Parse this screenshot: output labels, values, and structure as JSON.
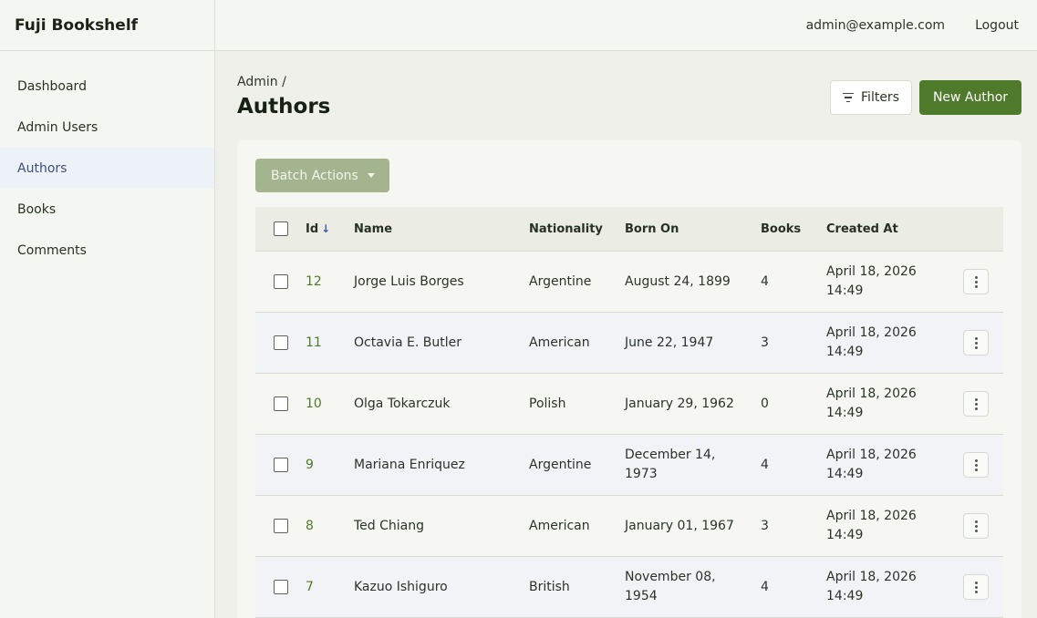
{
  "app": {
    "title": "Fuji Bookshelf"
  },
  "topbar": {
    "email": "admin@example.com",
    "logout": "Logout"
  },
  "sidebar": {
    "items": [
      {
        "label": "Dashboard"
      },
      {
        "label": "Admin Users"
      },
      {
        "label": "Authors",
        "active": true
      },
      {
        "label": "Books"
      },
      {
        "label": "Comments"
      }
    ]
  },
  "page": {
    "breadcrumb": "Admin /",
    "title": "Authors",
    "filters_label": "Filters",
    "new_label": "New Author",
    "batch_label": "Batch Actions"
  },
  "table": {
    "columns": {
      "id": "Id",
      "name": "Name",
      "nationality": "Nationality",
      "born_on": "Born On",
      "books": "Books",
      "created_at": "Created At"
    },
    "rows": [
      {
        "id": "12",
        "name": "Jorge Luis Borges",
        "nationality": "Argentine",
        "born_on": "August 24, 1899",
        "books": "4",
        "created_at": "April 18, 2026 14:49"
      },
      {
        "id": "11",
        "name": "Octavia E. Butler",
        "nationality": "American",
        "born_on": "June 22, 1947",
        "books": "3",
        "created_at": "April 18, 2026 14:49"
      },
      {
        "id": "10",
        "name": "Olga Tokarczuk",
        "nationality": "Polish",
        "born_on": "January 29, 1962",
        "books": "0",
        "created_at": "April 18, 2026 14:49"
      },
      {
        "id": "9",
        "name": "Mariana Enriquez",
        "nationality": "Argentine",
        "born_on": "December 14, 1973",
        "books": "4",
        "created_at": "April 18, 2026 14:49"
      },
      {
        "id": "8",
        "name": "Ted Chiang",
        "nationality": "American",
        "born_on": "January 01, 1967",
        "books": "3",
        "created_at": "April 18, 2026 14:49"
      },
      {
        "id": "7",
        "name": "Kazuo Ishiguro",
        "nationality": "British",
        "born_on": "November 08, 1954",
        "books": "4",
        "created_at": "April 18, 2026 14:49"
      }
    ]
  },
  "colors": {
    "accent": "#4f7a2c",
    "active_nav": "#edf1f8",
    "batch": "#a3b48f"
  }
}
